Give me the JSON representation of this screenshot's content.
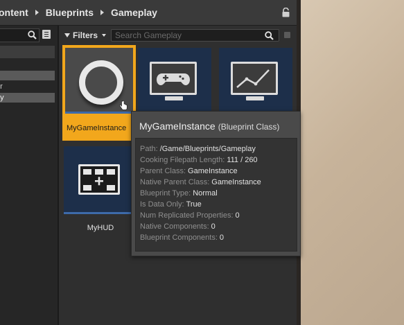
{
  "breadcrumb": [
    "ontent",
    "Blueprints",
    "Gameplay"
  ],
  "left_panel": {
    "tree_items": [
      {
        "label": "s",
        "selected": true
      },
      {
        "label": "er",
        "selected": false
      },
      {
        "label": "ay",
        "selected": true
      }
    ]
  },
  "filters": {
    "button_label": "Filters",
    "search_placeholder": "Search Gameplay"
  },
  "assets": [
    {
      "label": "MyGameInstance",
      "icon": "game-instance-ring-icon",
      "selected": true
    },
    {
      "label": "",
      "icon": "gamepad-monitor-icon",
      "selected": false
    },
    {
      "label": "",
      "icon": "line-graph-monitor-icon",
      "selected": false
    },
    {
      "label": "MyHUD",
      "icon": "hud-layout-icon",
      "selected": false
    }
  ],
  "tooltip": {
    "title": "MyGameInstance",
    "subtitle": "(Blueprint Class)",
    "rows": [
      {
        "key": "Path:",
        "value": "/Game/Blueprints/Gameplay"
      },
      {
        "key": "Cooking Filepath Length:",
        "value": "111 / 260"
      },
      {
        "key": "Parent Class:",
        "value": "GameInstance"
      },
      {
        "key": "Native Parent Class:",
        "value": "GameInstance"
      },
      {
        "key": "Blueprint Type:",
        "value": "Normal"
      },
      {
        "key": "Is Data Only:",
        "value": "True"
      },
      {
        "key": "Num Replicated Properties:",
        "value": "0"
      },
      {
        "key": "Native Components:",
        "value": "0"
      },
      {
        "key": "Blueprint Components:",
        "value": "0"
      }
    ]
  },
  "colors": {
    "selection_accent": "#f2a71c",
    "thumbnail_bg": "#1d2f4a",
    "class_bar": "#3d6aaa"
  }
}
